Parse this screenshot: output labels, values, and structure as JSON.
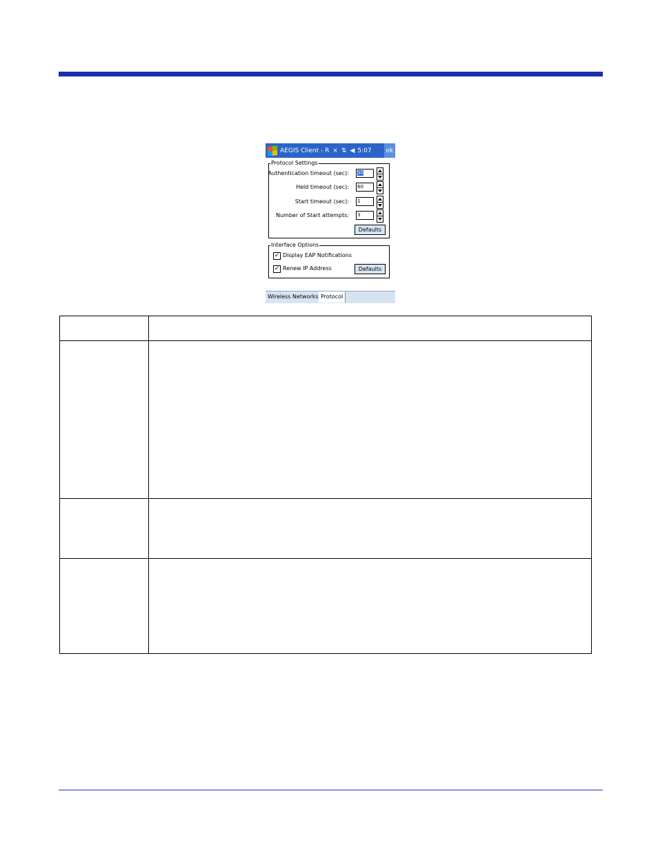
{
  "titlebar": {
    "title": "AEGIS Client - R",
    "icons": [
      "windows-start-icon",
      "connectivity-icon",
      "signal-icon",
      "volume-icon"
    ],
    "time": "5:07",
    "ok_label": "ok",
    "colors": {
      "titlebar": "#2a64c8",
      "header_rule": "#1c2fae"
    }
  },
  "protocol_settings": {
    "legend": "Protocol Settings",
    "fields": [
      {
        "label": "Authentication timeout (sec):",
        "value": "30"
      },
      {
        "label": "Held timeout (sec):",
        "value": "60"
      },
      {
        "label": "Start timeout (sec):",
        "value": "1"
      },
      {
        "label": "Number of Start attempts:",
        "value": "3"
      }
    ],
    "defaults_label": "Defaults"
  },
  "interface_options": {
    "legend": "Interface Options",
    "checkboxes": [
      {
        "label": "Display EAP Notifications",
        "checked": true
      },
      {
        "label": "Renew IP Address",
        "checked": true
      }
    ],
    "defaults_label": "Defaults"
  },
  "tabs": [
    {
      "label": "Wireless Networks",
      "active": false
    },
    {
      "label": "Protocol",
      "active": true
    }
  ]
}
